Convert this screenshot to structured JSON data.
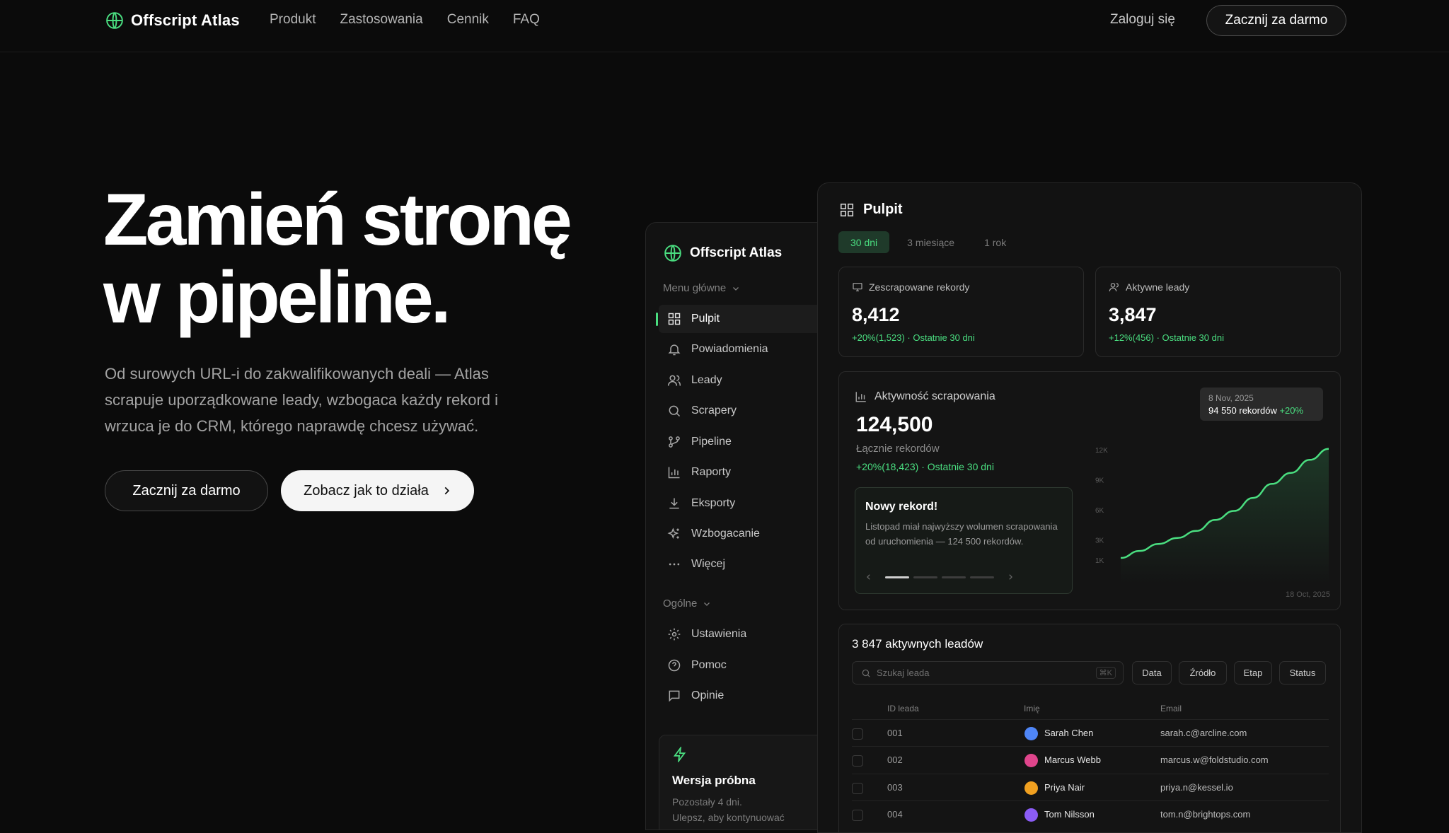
{
  "header": {
    "brand": "Offscript Atlas",
    "nav": [
      "Produkt",
      "Zastosowania",
      "Cennik",
      "FAQ"
    ],
    "login": "Zaloguj się",
    "cta": "Zacznij za darmo"
  },
  "hero": {
    "title_line1": "Zamień stronę",
    "title_line2": "w pipeline.",
    "description": "Od surowych URL-i do zakwalifikowanych deali — Atlas scrapuje uporządkowane leady, wzbogaca każdy rekord i wrzuca je do CRM, którego naprawdę chcesz używać.",
    "primary_button": "Zacznij za darmo",
    "secondary_button": "Zobacz jak to działa"
  },
  "sidebar": {
    "brand": "Offscript Atlas",
    "main_menu_label": "Menu główne",
    "items": [
      {
        "label": "Pulpit",
        "icon": "grid-icon"
      },
      {
        "label": "Powiadomienia",
        "icon": "bell-icon"
      },
      {
        "label": "Leady",
        "icon": "users-icon"
      },
      {
        "label": "Scrapery",
        "icon": "search-icon"
      },
      {
        "label": "Pipeline",
        "icon": "git-branch-icon"
      },
      {
        "label": "Raporty",
        "icon": "bar-chart-icon"
      },
      {
        "label": "Eksporty",
        "icon": "download-icon"
      },
      {
        "label": "Wzbogacanie",
        "icon": "sparkles-icon"
      },
      {
        "label": "Więcej",
        "icon": "more-icon"
      }
    ],
    "general_label": "Ogólne",
    "general_items": [
      {
        "label": "Ustawienia",
        "icon": "gear-icon"
      },
      {
        "label": "Pomoc",
        "icon": "help-icon"
      },
      {
        "label": "Opinie",
        "icon": "message-icon"
      }
    ],
    "trial": {
      "title": "Wersja próbna",
      "line1": "Pozostały 4 dni.",
      "line2": "Ulepsz, aby kontynuować"
    }
  },
  "dashboard": {
    "title": "Pulpit",
    "tabs": [
      "30 dni",
      "3 miesiące",
      "1 rok"
    ],
    "kpi1": {
      "label": "Zescrapowane rekordy",
      "value": "8,412",
      "delta": "+20%(1,523) · Ostatnie 30 dni"
    },
    "kpi2": {
      "label": "Aktywne leady",
      "value": "3,847",
      "delta": "+12%(456) · Ostatnie 30 dni"
    },
    "activity": {
      "title": "Aktywność scrapowania",
      "value": "124,500",
      "sub": "Łącznie rekordów",
      "delta": "+20%(18,423) · Ostatnie 30 dni",
      "record_title": "Nowy rekord!",
      "record_body": "Listopad miał najwyższy wolumen scrapowania od uruchomienia — 124 500 rekordów.",
      "tooltip_date": "8 Nov, 2025",
      "tooltip_value": "94 550 rekordów",
      "tooltip_delta": "+20%"
    },
    "leads": {
      "title": "3 847 aktywnych leadów",
      "search_placeholder": "Szukaj leada",
      "shortcut": "⌘K",
      "filters": [
        "Data",
        "Źródło",
        "Etap",
        "Status"
      ],
      "columns": [
        "ID leada",
        "Imię",
        "Email"
      ],
      "rows": [
        {
          "id": "001",
          "name": "Sarah Chen",
          "email": "sarah.c@arcline.com",
          "color": "#4f86f7"
        },
        {
          "id": "002",
          "name": "Marcus Webb",
          "email": "marcus.w@foldstudio.com",
          "color": "#e0458c"
        },
        {
          "id": "003",
          "name": "Priya Nair",
          "email": "priya.n@kessel.io",
          "color": "#f0a020"
        },
        {
          "id": "004",
          "name": "Tom Nilsson",
          "email": "tom.n@brightops.com",
          "color": "#8b5cf6"
        }
      ]
    }
  },
  "chart_data": {
    "type": "area",
    "yticks": [
      "12K",
      "9K",
      "6K",
      "3K",
      "1K"
    ],
    "x_end_label": "18 Oct, 2025",
    "values": [
      1.2,
      1.9,
      2.6,
      3.2,
      3.9,
      5.0,
      5.9,
      7.2,
      8.6,
      9.7,
      11.0,
      12.1
    ],
    "ylim": [
      0,
      13
    ]
  },
  "colors": {
    "accent": "#4ade80",
    "background": "#0b0b0b"
  }
}
